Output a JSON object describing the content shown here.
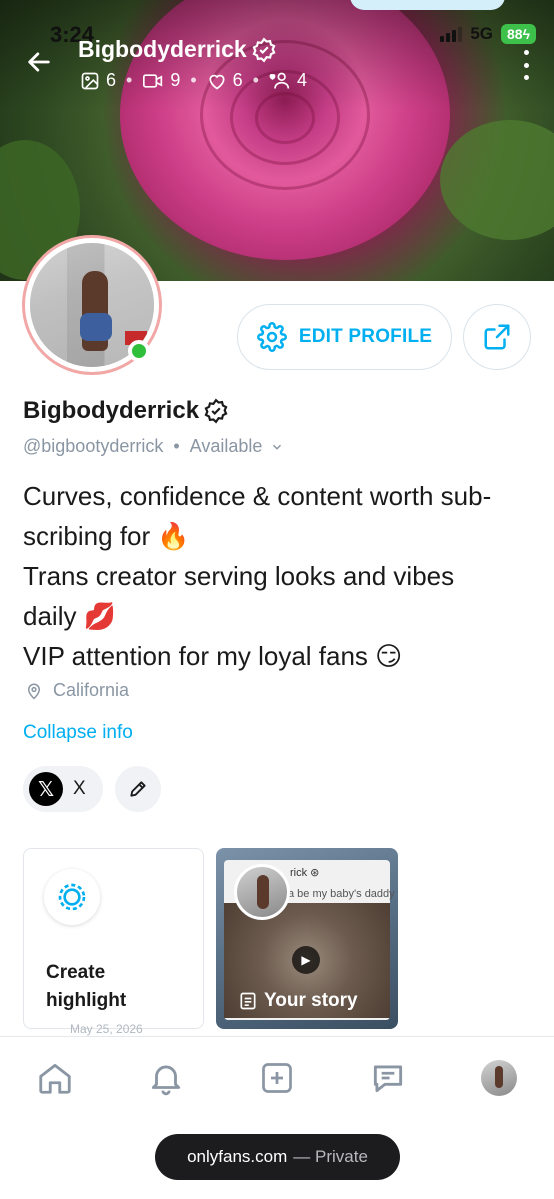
{
  "status_bar": {
    "time": "3:24",
    "network": "5G",
    "battery": "88"
  },
  "cover": {
    "name": "Bigbodyderrick",
    "stats": {
      "photos": "6",
      "videos": "9",
      "likes": "6",
      "fans": "4"
    }
  },
  "profile": {
    "edit_label": "EDIT PROFILE",
    "name": "Bigbodyderrick",
    "handle": "@bigbootyderrick",
    "availability": "Available",
    "bio_lines": [
      "Curves, confidence & content worth sub-",
      "scribing for 🔥",
      "Trans creator serving looks and vibes",
      "daily 💋",
      "VIP attention for my loyal fans 😏"
    ],
    "location": "California",
    "collapse_label": "Collapse info"
  },
  "social": {
    "x_label": "X",
    "x_logo": "𝕏"
  },
  "highlights": {
    "create_label_1": "Create",
    "create_label_2": "highlight",
    "story_label": "Your story",
    "story_snippet_1": "rick ⊛",
    "story_snippet_2": "a be my baby's daddy",
    "story_date": "May 25, 2026"
  },
  "browser": {
    "domain": "onlyfans.com",
    "mode": "— Private"
  },
  "colors": {
    "accent": "#00aff0",
    "muted": "#8a96a3",
    "online": "#2fbf3b"
  }
}
